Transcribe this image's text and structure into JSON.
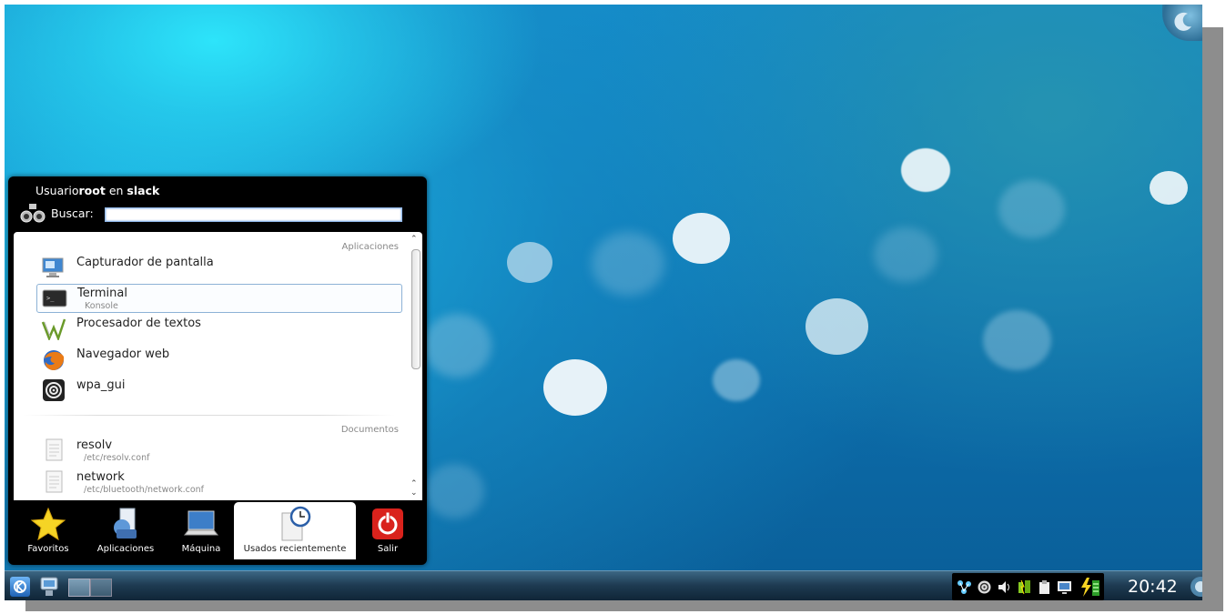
{
  "menu": {
    "title_prefix": "Usuario",
    "title_user": "root",
    "title_mid": " en ",
    "title_host": "slack",
    "search_label": "Buscar:",
    "search_value": "",
    "sections": {
      "apps": "Aplicaciones",
      "docs": "Documentos"
    },
    "apps": [
      {
        "label": "Capturador de pantalla",
        "sub": "",
        "icon": "screenshot-icon"
      },
      {
        "label": "Terminal",
        "sub": "Konsole",
        "icon": "terminal-icon"
      },
      {
        "label": "Procesador de textos",
        "sub": "",
        "icon": "word-processor-icon"
      },
      {
        "label": "Navegador web",
        "sub": "",
        "icon": "firefox-icon"
      },
      {
        "label": "wpa_gui",
        "sub": "",
        "icon": "wifi-icon"
      }
    ],
    "docs": [
      {
        "label": "resolv",
        "sub": "/etc/resolv.conf",
        "icon": "document-icon"
      },
      {
        "label": "network",
        "sub": "/etc/bluetooth/network.conf",
        "icon": "document-icon"
      }
    ],
    "tabs": [
      {
        "label": "Favoritos",
        "icon": "star-icon"
      },
      {
        "label": "Aplicaciones",
        "icon": "applications-icon"
      },
      {
        "label": "Máquina",
        "icon": "laptop-icon"
      },
      {
        "label": "Usados recientemente",
        "icon": "recent-clock-icon"
      },
      {
        "label": "Salir",
        "icon": "power-icon"
      }
    ],
    "active_tab": "Usados recientemente"
  },
  "panel": {
    "clock": "20:42",
    "tray_icons": [
      "network-manager-icon",
      "wifi-icon",
      "volume-icon",
      "battery-status-icon",
      "clipboard-icon",
      "monitor-icon",
      "power-charging-icon"
    ]
  },
  "colors": {
    "accent": "#1f7fd0",
    "power_red": "#d9221c",
    "menu_bg": "#000000"
  }
}
